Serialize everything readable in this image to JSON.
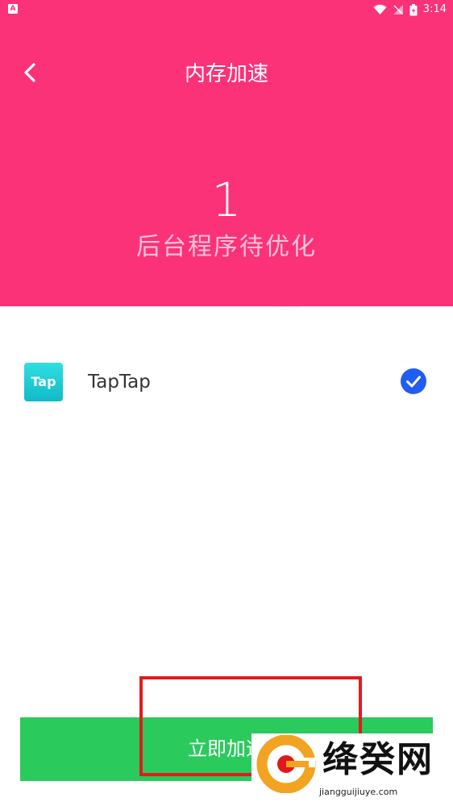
{
  "status_bar": {
    "time": "3:14",
    "notification_icon": "A"
  },
  "header": {
    "back_icon": "chevron-left-icon",
    "title": "内存加速"
  },
  "summary": {
    "count": "1",
    "label": "后台程序待优化"
  },
  "apps": [
    {
      "name": "TapTap",
      "icon_text": "Tap",
      "checked": true
    }
  ],
  "action": {
    "button_label": "立即加速"
  },
  "watermark": {
    "text": "绛癸网",
    "url": "jiangguijiuye.com"
  },
  "colors": {
    "header_bg": "#fb3278",
    "button_bg": "#2bca5d",
    "check_blue": "#1f5ef0",
    "annotation_red": "#e01c1c"
  }
}
